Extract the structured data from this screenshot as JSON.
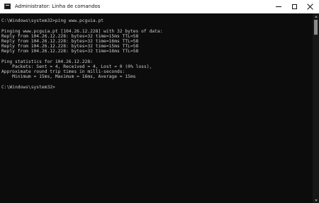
{
  "window": {
    "title": "Administrator: Linha de comandos",
    "icon": "cmd-icon"
  },
  "controls": {
    "minimize": "minimize-icon",
    "maximize": "maximize-icon",
    "close": "close-icon"
  },
  "console": {
    "lines": [
      "",
      "C:\\Windows\\system32>ping www.pcguia.pt",
      "",
      "Pinging www.pcguia.pt [104.26.12.228] with 32 bytes of data:",
      "Reply from 104.26.12.228: bytes=32 time=15ms TTL=58",
      "Reply from 104.26.12.228: bytes=32 time=16ms TTL=58",
      "Reply from 104.26.12.228: bytes=32 time=15ms TTL=58",
      "Reply from 104.26.12.228: bytes=32 time=16ms TTL=58",
      "",
      "Ping statistics for 104.26.12.228:",
      "    Packets: Sent = 4, Received = 4, Lost = 0 (0% loss),",
      "Approximate round trip times in milli-seconds:",
      "    Minimum = 15ms, Maximum = 16ms, Average = 15ms",
      "",
      "C:\\Windows\\system32>"
    ]
  },
  "colors": {
    "background": "#0c0c0c",
    "text": "#cccccc",
    "titlebar": "#ffffff"
  }
}
